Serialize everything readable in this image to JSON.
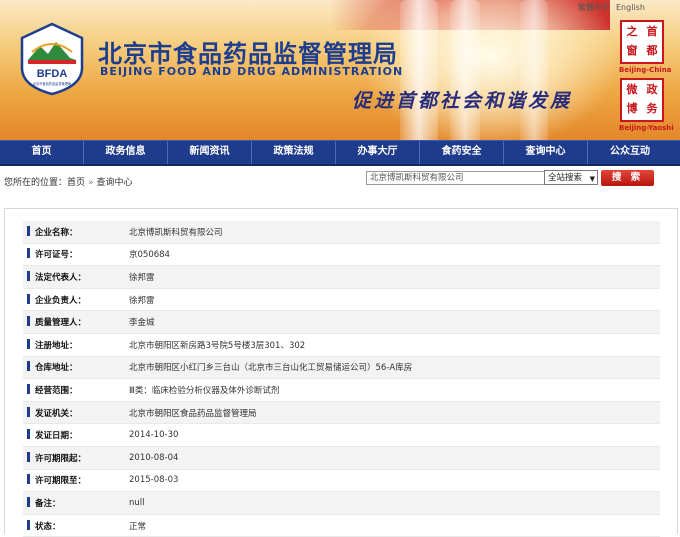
{
  "header": {
    "logo_text": "BFDA",
    "logo_caption": "北京市食品药品监督管理局",
    "title_cn": "北京市食品药品监督管理局",
    "title_en": "BEIJING FOOD AND DRUG ADMINISTRATION",
    "slogan": "促进首都社会和谐发展",
    "lang_links": [
      "繁體中文",
      "English"
    ],
    "seal_top": {
      "chars": [
        "首",
        "都",
        "之",
        "窗"
      ],
      "label": "Beijing-China"
    },
    "seal_bottom": {
      "chars": [
        "政",
        "务",
        "微",
        "博"
      ],
      "label": "Beijing-Yaoshi"
    }
  },
  "nav": {
    "items": [
      "首页",
      "政务信息",
      "新闻资讯",
      "政策法规",
      "办事大厅",
      "食药安全",
      "查询中心",
      "公众互动"
    ]
  },
  "breadcrumb": {
    "prefix": "您所在的位置：",
    "items": [
      "首页",
      "查询中心"
    ]
  },
  "search": {
    "value": "北京博凯斯科贸有限公司",
    "scope": "全站搜索",
    "button_label": "搜 索"
  },
  "detail": {
    "rows": [
      {
        "label": "企业名称：",
        "value": "北京博凯斯科贸有限公司"
      },
      {
        "label": "许可证号：",
        "value": "京050684"
      },
      {
        "label": "法定代表人：",
        "value": "徐邦雷"
      },
      {
        "label": "企业负责人：",
        "value": "徐邦雷"
      },
      {
        "label": "质量管理人：",
        "value": "李金城"
      },
      {
        "label": "注册地址：",
        "value": "北京市朝阳区新房路3号院5号楼3层301、302"
      },
      {
        "label": "仓库地址：",
        "value": "北京市朝阳区小红门乡三台山（北京市三台山化工贸易储运公司）56-A库房"
      },
      {
        "label": "经营范围：",
        "value": "Ⅲ类：临床检验分析仪器及体外诊断试剂"
      },
      {
        "label": "发证机关：",
        "value": "北京市朝阳区食品药品监督管理局"
      },
      {
        "label": "发证日期：",
        "value": "2014-10-30"
      },
      {
        "label": "许可期限起：",
        "value": "2010-08-04"
      },
      {
        "label": "许可期限至：",
        "value": "2015-08-03"
      },
      {
        "label": "备注：",
        "value": "null"
      },
      {
        "label": "状态：",
        "value": "正常"
      }
    ]
  },
  "colors": {
    "nav_bg": "#1f3c8c",
    "title_blue": "#1d3d8f",
    "accent_red": "#c8161d",
    "header_orange": "#eea845"
  }
}
